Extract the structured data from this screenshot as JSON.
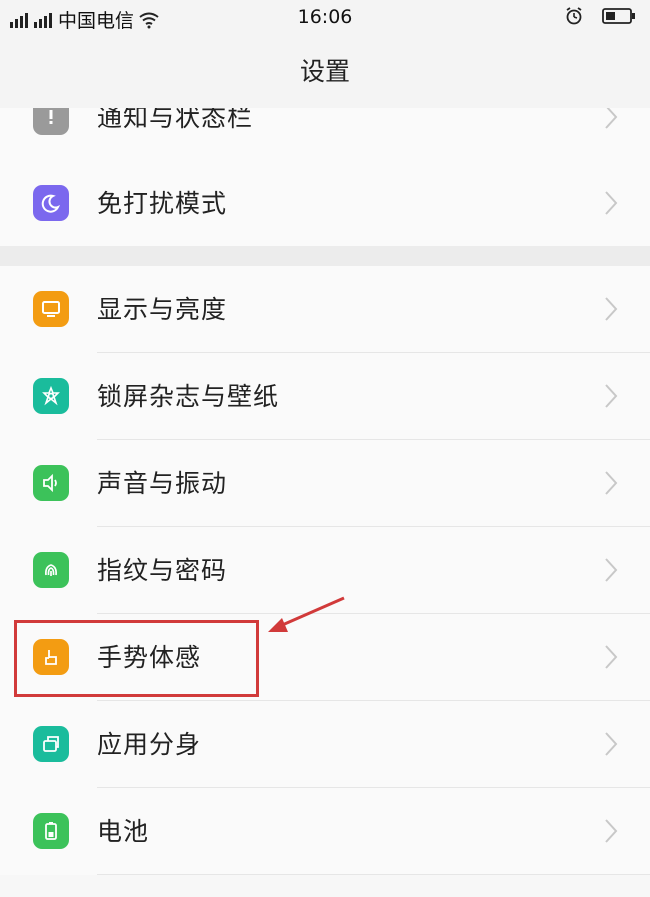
{
  "status_bar": {
    "carrier": "中国电信",
    "time": "16:06",
    "signal_icon": "signal-bars-icon",
    "wifi_icon": "wifi-icon",
    "alarm_icon": "alarm-clock-icon",
    "battery_icon": "battery-icon"
  },
  "header": {
    "title": "设置"
  },
  "settings": {
    "items": [
      {
        "label": "通知与状态栏",
        "icon": "notification-icon",
        "color": "#9a9a9a"
      },
      {
        "label": "免打扰模式",
        "icon": "moon-icon",
        "color": "#7b68ee"
      },
      {
        "label": "显示与亮度",
        "icon": "display-icon",
        "color": "#f39c12"
      },
      {
        "label": "锁屏杂志与壁纸",
        "icon": "flower-icon",
        "color": "#1abc9c"
      },
      {
        "label": "声音与振动",
        "icon": "speaker-icon",
        "color": "#3cc25a"
      },
      {
        "label": "指纹与密码",
        "icon": "fingerprint-icon",
        "color": "#3cc25a"
      },
      {
        "label": "手势体感",
        "icon": "hand-gesture-icon",
        "color": "#f39c12"
      },
      {
        "label": "应用分身",
        "icon": "app-clone-icon",
        "color": "#1abc9c"
      },
      {
        "label": "电池",
        "icon": "battery-settings-icon",
        "color": "#3cc25a"
      }
    ]
  },
  "annotation": {
    "highlight_color": "#d13a3a"
  }
}
